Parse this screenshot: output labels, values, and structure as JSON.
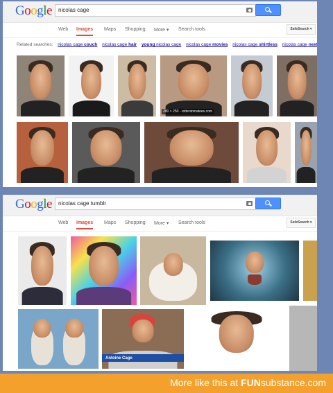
{
  "logo": "Google",
  "colors": {
    "google_blue": "#3369e8",
    "google_red": "#d50f25",
    "google_yellow": "#eeb211",
    "google_green": "#009925",
    "active_tab": "#dd4b39",
    "banner": "#f3a12c"
  },
  "panel1": {
    "query": "nicolas cage",
    "tabs": [
      "Web",
      "Images",
      "Maps",
      "Shopping",
      "More ▾",
      "Search tools"
    ],
    "active_tab": "Images",
    "safesearch": "SafeSearch ▾",
    "related_label": "Related searches:",
    "related": [
      {
        "base": "nicolas cage ",
        "bold": "couch"
      },
      {
        "base": "nicolas cage ",
        "bold": "hair"
      },
      {
        "base": "",
        "bold": "young",
        "after": " nicolas cage"
      },
      {
        "base": "nicolas cage ",
        "bold": "movies"
      },
      {
        "base": "nicolas cage ",
        "bold": "shirtless"
      },
      {
        "base": "nicolas cage ",
        "bold": "next"
      }
    ],
    "caption": "280 × 250 - rottentomatoes.com"
  },
  "panel2": {
    "query": "nicolas cage tumblr",
    "tabs": [
      "Web",
      "Images",
      "Maps",
      "Shopping",
      "More ▾",
      "Search tools"
    ],
    "active_tab": "Images",
    "safesearch": "SafeSearch ▾",
    "news_name": "Antoine Cage"
  },
  "banner": {
    "prefix": "More like this at ",
    "brand_bold": "FUN",
    "brand_rest": "substance",
    "suffix": ".com"
  }
}
